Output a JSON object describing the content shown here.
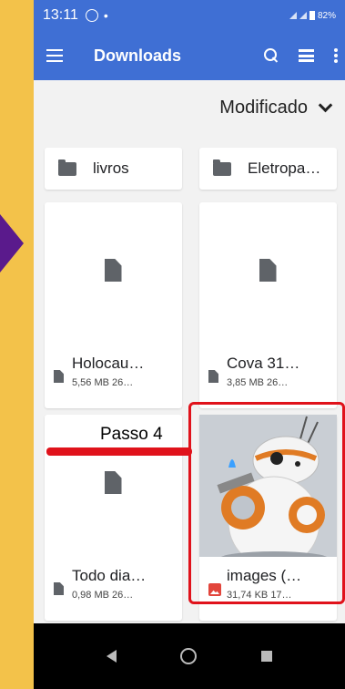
{
  "status": {
    "time": "13:11",
    "battery": "82%"
  },
  "appbar": {
    "title": "Downloads"
  },
  "sort": {
    "label": "Modificado"
  },
  "folders": [
    {
      "name": "livros"
    },
    {
      "name": "Eletropa…"
    }
  ],
  "files": [
    {
      "name": "Holocau…",
      "meta": "5,56 MB 26…"
    },
    {
      "name": "Cova 31…",
      "meta": "3,85 MB 26…"
    },
    {
      "name": "Todo dia…",
      "meta": "0,98 MB 26…"
    },
    {
      "name": "images (…",
      "meta": "31,74 KB 17…"
    }
  ],
  "annotation": {
    "text": "Passo 4"
  },
  "colors": {
    "primary": "#3f6fd4",
    "highlight": "#e0121b",
    "background": "#f3c24a",
    "arrow": "#5a1a8c"
  }
}
